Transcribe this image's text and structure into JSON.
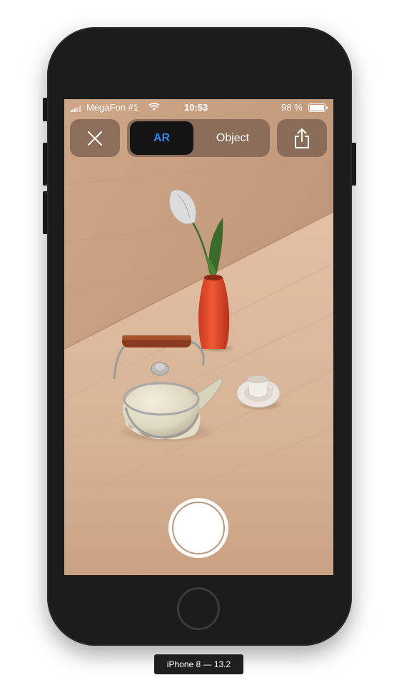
{
  "status_bar": {
    "carrier": "MegaFon #1",
    "time": "10:53",
    "battery_percent": "98 %",
    "battery_level": 0.98,
    "icons": [
      "signal-bars",
      "wifi-icon",
      "battery-icon"
    ]
  },
  "toolbar": {
    "close_icon": "close-icon",
    "share_icon": "share-icon",
    "segments": [
      {
        "label": "AR",
        "selected": true
      },
      {
        "label": "Object",
        "selected": false
      }
    ]
  },
  "shutter": {
    "icon": "shutter-button"
  },
  "device_label": "iPhone 8 — 13.2",
  "colors": {
    "segment_selected_text": "#2f84f2",
    "segment_selected_bg": "#141414",
    "control_bg": "#7a604e",
    "phone_body": "#1b1b1b"
  }
}
